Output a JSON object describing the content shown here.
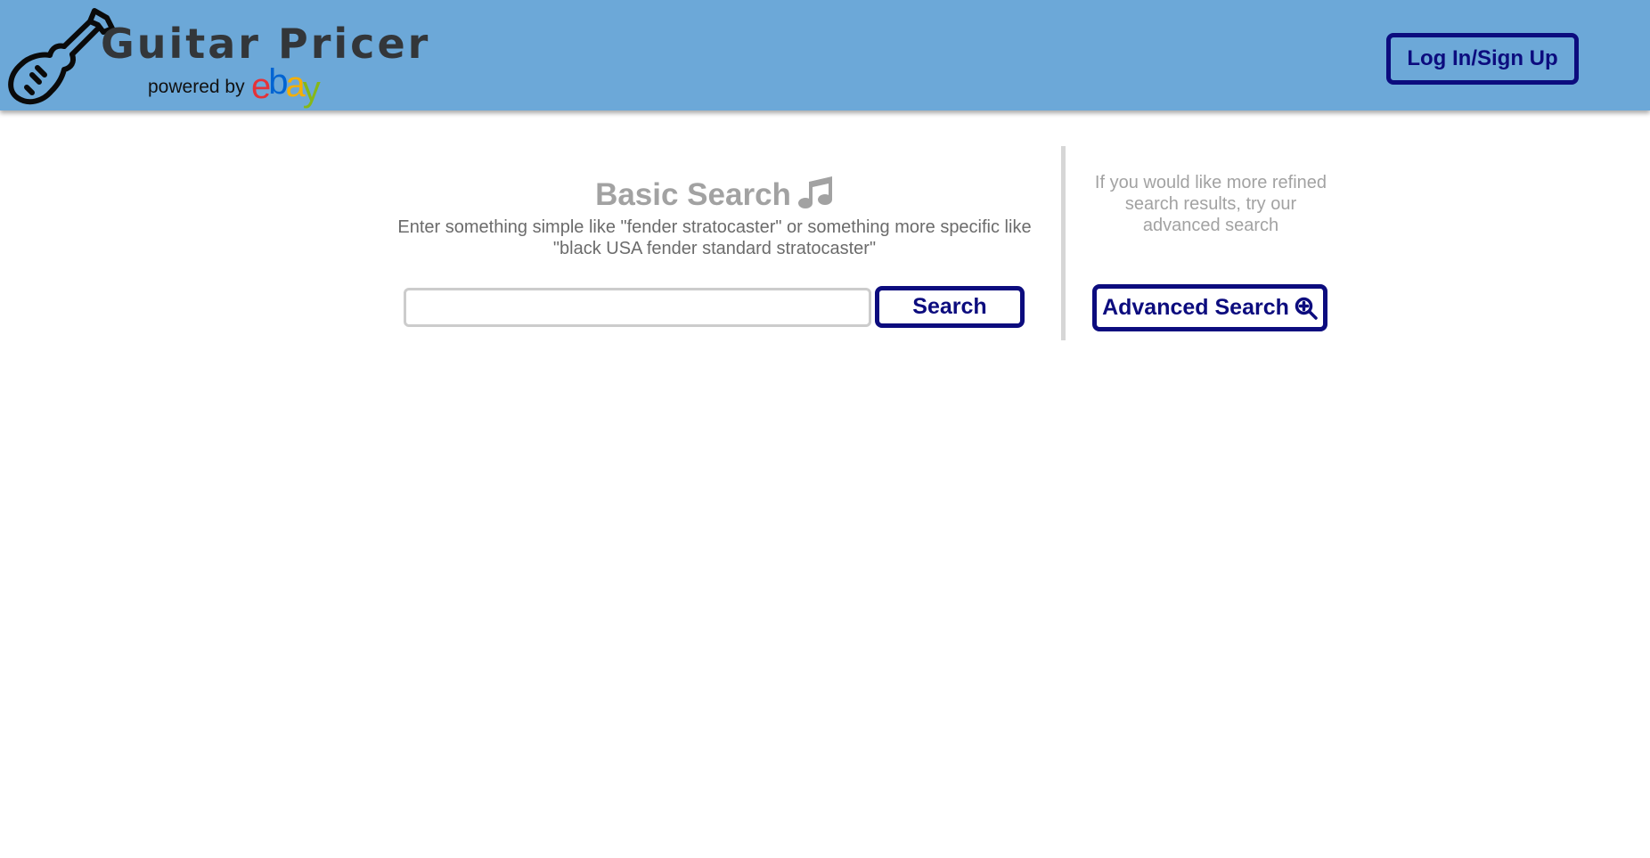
{
  "header": {
    "brand_title": "Guitar Pricer",
    "powered_by": "powered by",
    "ebay_letters": [
      "e",
      "b",
      "a",
      "y"
    ],
    "login_label": "Log In/Sign Up",
    "background_color": "#6ca8d8"
  },
  "basic_search": {
    "title": "Basic Search",
    "title_icon": "music-note-icon",
    "subtitle": "Enter something simple like \"fender stratocaster\" or something more specific like \"black USA fender standard stratocaster\"",
    "input_value": "",
    "button_label": "Search"
  },
  "advanced_search": {
    "hint": "If you would like more refined search results, try our advanced search",
    "button_label": "Advanced Search",
    "button_icon": "zoom-in-icon"
  },
  "colors": {
    "button_border": "#0c0c7e",
    "muted_text": "#a2a2a2",
    "ebay_e": "#e53238",
    "ebay_b": "#0064d2",
    "ebay_a": "#f5af02",
    "ebay_y": "#86b817"
  }
}
